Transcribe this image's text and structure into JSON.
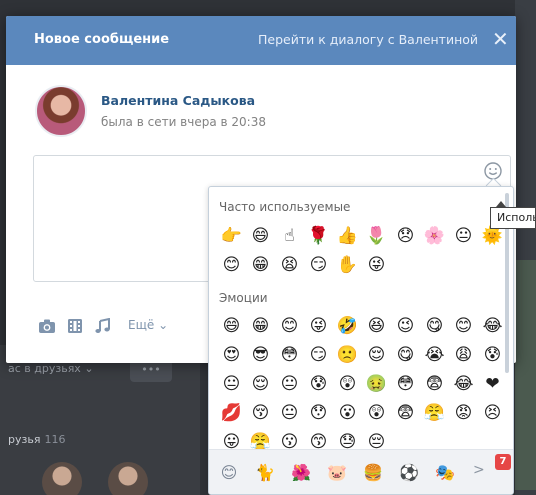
{
  "modal": {
    "title": "Новое сообщение",
    "link": "Перейти к диалогу с Валентиной",
    "close_icon": "close-icon"
  },
  "recipient": {
    "name": "Валентина Садыкова",
    "status": "была в сети вчера в 20:38"
  },
  "composer": {
    "value": "",
    "smile_icon": "smile-icon"
  },
  "toolbar": {
    "photo_icon": "camera-icon",
    "video_icon": "film-icon",
    "audio_icon": "music-icon",
    "more_label": "Ещё"
  },
  "tooltip": {
    "text": "Использовать"
  },
  "emoji_panel": {
    "section_frequent": "Часто используемые",
    "section_emotions": "Эмоции",
    "frequent": [
      "👉",
      "😄",
      "☝",
      "🌹",
      "👍",
      "🌷",
      "😞",
      "🌸",
      "😐",
      "🌞",
      "😊",
      "😁",
      "😫",
      "😏",
      "✋",
      "😜"
    ],
    "emotions": [
      "😄",
      "😁",
      "😊",
      "😜",
      "🤣",
      "😆",
      "😉",
      "😋",
      "😊",
      "😂",
      "😍",
      "😎",
      "😳",
      "😏",
      "🙁",
      "😌",
      "😋",
      "😭",
      "😩",
      "😰",
      "😐",
      "😌",
      "😐",
      "😰",
      "😲",
      "🤢",
      "😳",
      "😨",
      "😂",
      "❤",
      "💋",
      "😚",
      "😐",
      "😯",
      "😮",
      "😲",
      "😨",
      "😤",
      "😡",
      "😣",
      "😛",
      "😤",
      "😗",
      "😙",
      "😓",
      "😔"
    ],
    "tabs": [
      "😊",
      "🐈",
      "🌺",
      "🐷",
      "🍔",
      "⚽",
      "🎭"
    ],
    "badge": "7",
    "next_label": ">"
  },
  "background": {
    "friends_status": "ас в друзьях ⌄",
    "more_dots": "•••",
    "friends_label": "рузья",
    "friends_count": "116"
  }
}
